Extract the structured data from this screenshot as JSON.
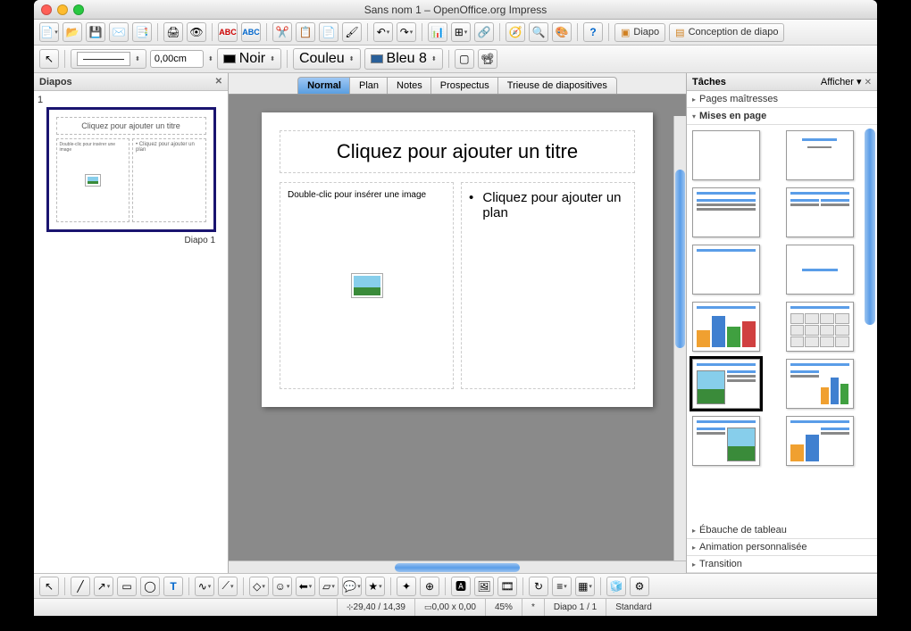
{
  "window": {
    "title": "Sans nom 1 – OpenOffice.org Impress"
  },
  "sidebar": {
    "title": "Diapos",
    "slide_number": "1",
    "thumb_title": "Cliquez pour ajouter un titre",
    "thumb_left": "Double-clic pour insérer une image",
    "thumb_right": "Cliquez pour ajouter un plan",
    "caption": "Diapo 1"
  },
  "tabs": {
    "normal": "Normal",
    "plan": "Plan",
    "notes": "Notes",
    "prospectus": "Prospectus",
    "trieuse": "Trieuse de diapositives"
  },
  "slide": {
    "title": "Cliquez pour ajouter un titre",
    "left_text": "Double-clic pour insérer une image",
    "right_text": "Cliquez pour ajouter un plan"
  },
  "tasks": {
    "title": "Tâches",
    "afficher": "Afficher",
    "pages_maitresses": "Pages maîtresses",
    "mises_en_page": "Mises en page",
    "ebauche": "Ébauche de tableau",
    "animation": "Animation personnalisée",
    "transition": "Transition"
  },
  "toolbar2": {
    "width": "0,00cm",
    "color1": "Noir",
    "fill": "Couleu",
    "color2": "Bleu 8"
  },
  "toolbar_right": {
    "diapo": "Diapo",
    "conception": "Conception de diapo"
  },
  "status": {
    "coords": "29,40 / 14,39",
    "size": "0,00 x 0,00",
    "zoom": "45%",
    "modified": "*",
    "slide": "Diapo 1 / 1",
    "template": "Standard"
  }
}
